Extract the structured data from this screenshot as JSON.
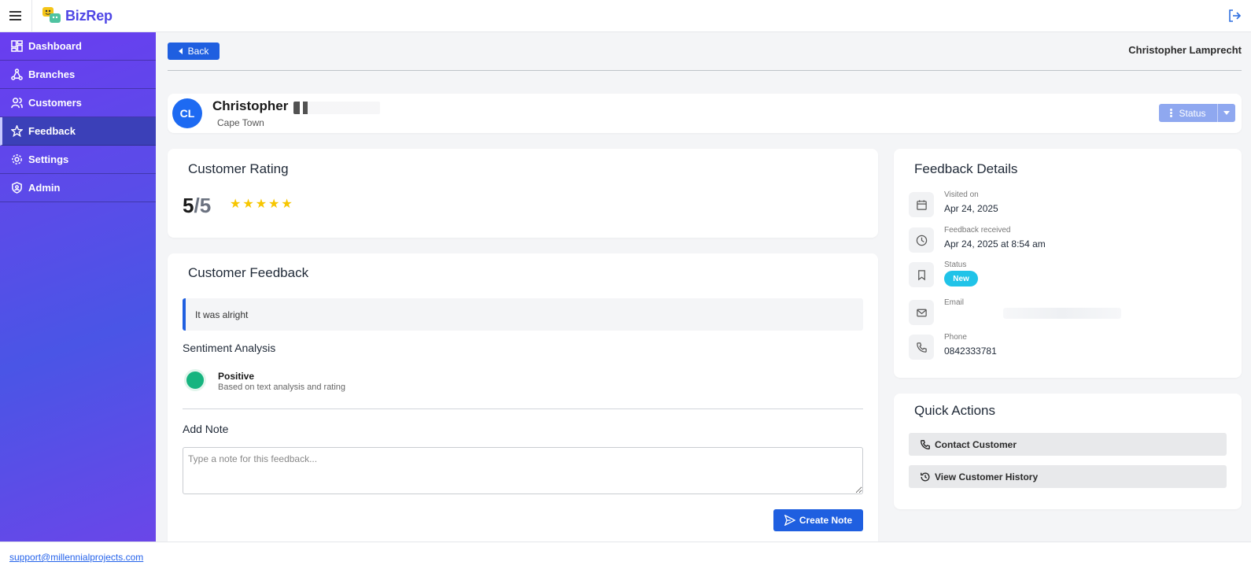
{
  "app": {
    "name": "BizRep",
    "brand_color": "#4f46e5"
  },
  "sidebar": {
    "items": [
      {
        "label": "Dashboard",
        "icon": "dashboard-icon"
      },
      {
        "label": "Branches",
        "icon": "branches-icon"
      },
      {
        "label": "Customers",
        "icon": "customers-icon"
      },
      {
        "label": "Feedback",
        "icon": "star-icon",
        "active": true
      },
      {
        "label": "Settings",
        "icon": "gear-icon"
      },
      {
        "label": "Admin",
        "icon": "shield-icon"
      }
    ]
  },
  "header": {
    "back_label": "Back",
    "user_name": "Christopher Lamprecht"
  },
  "customer": {
    "initials": "CL",
    "name": "Christopher",
    "city": "Cape Town",
    "status_button": "Status"
  },
  "rating": {
    "title": "Customer Rating",
    "value": "5",
    "max": "/5",
    "stars": 5
  },
  "feedback": {
    "title": "Customer Feedback",
    "text": "It was alright",
    "sentiment_title": "Sentiment Analysis",
    "sentiment": "Positive",
    "sentiment_note": "Based on text analysis and rating",
    "sentiment_color": "#16b47f",
    "note_title": "Add Note",
    "note_placeholder": "Type a note for this feedback...",
    "create_label": "Create Note"
  },
  "details": {
    "title": "Feedback Details",
    "visited_label": "Visited on",
    "visited_value": "Apr 24, 2025",
    "received_label": "Feedback received",
    "received_value": "Apr 24, 2025 at 8:54 am",
    "status_label": "Status",
    "status_value": "New",
    "status_color": "#20c3e8",
    "email_label": "Email",
    "phone_label": "Phone",
    "phone_value": "0842333781"
  },
  "actions": {
    "title": "Quick Actions",
    "contact_label": "Contact Customer",
    "history_label": "View Customer History"
  },
  "footer": {
    "email": "support@millennialprojects.com"
  }
}
